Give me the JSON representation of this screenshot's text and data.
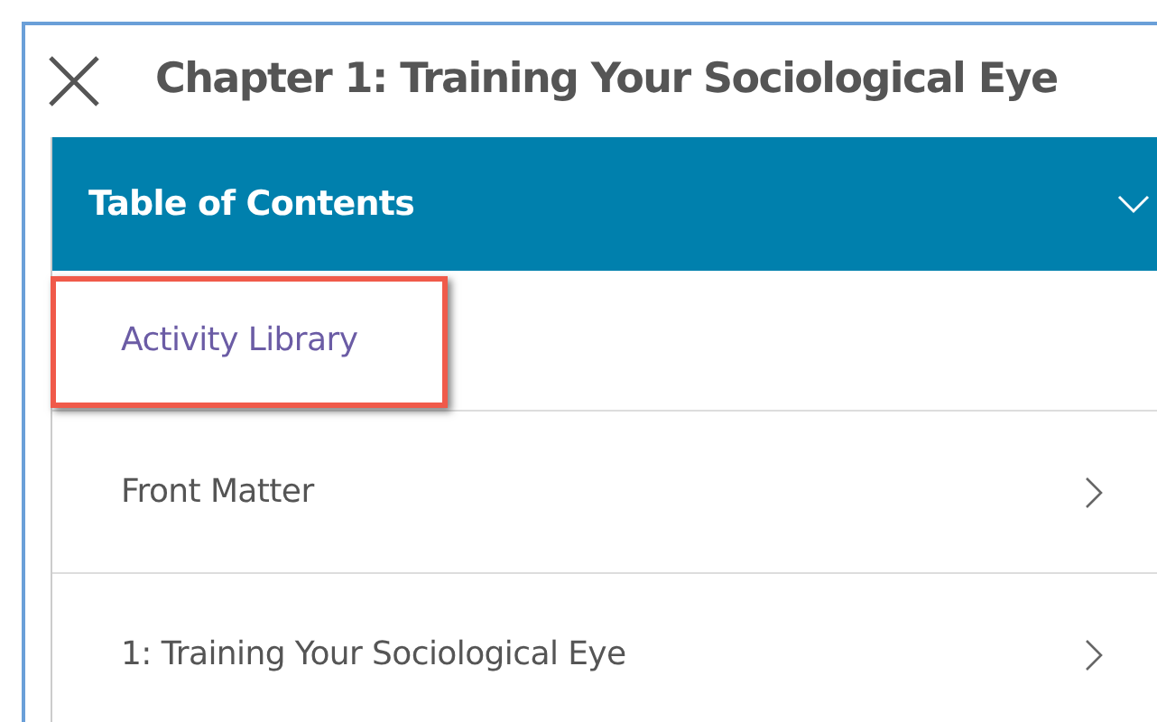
{
  "title": "Chapter 1: Training Your Sociological Eye",
  "toc": {
    "heading": "Table of Contents",
    "expanded": true,
    "items": [
      {
        "label": "Activity Library",
        "kind": "link",
        "highlighted": true
      },
      {
        "label": "Front Matter",
        "kind": "section",
        "highlighted": false
      },
      {
        "label": "1: Training Your Sociological Eye",
        "kind": "section",
        "highlighted": false
      }
    ]
  }
}
